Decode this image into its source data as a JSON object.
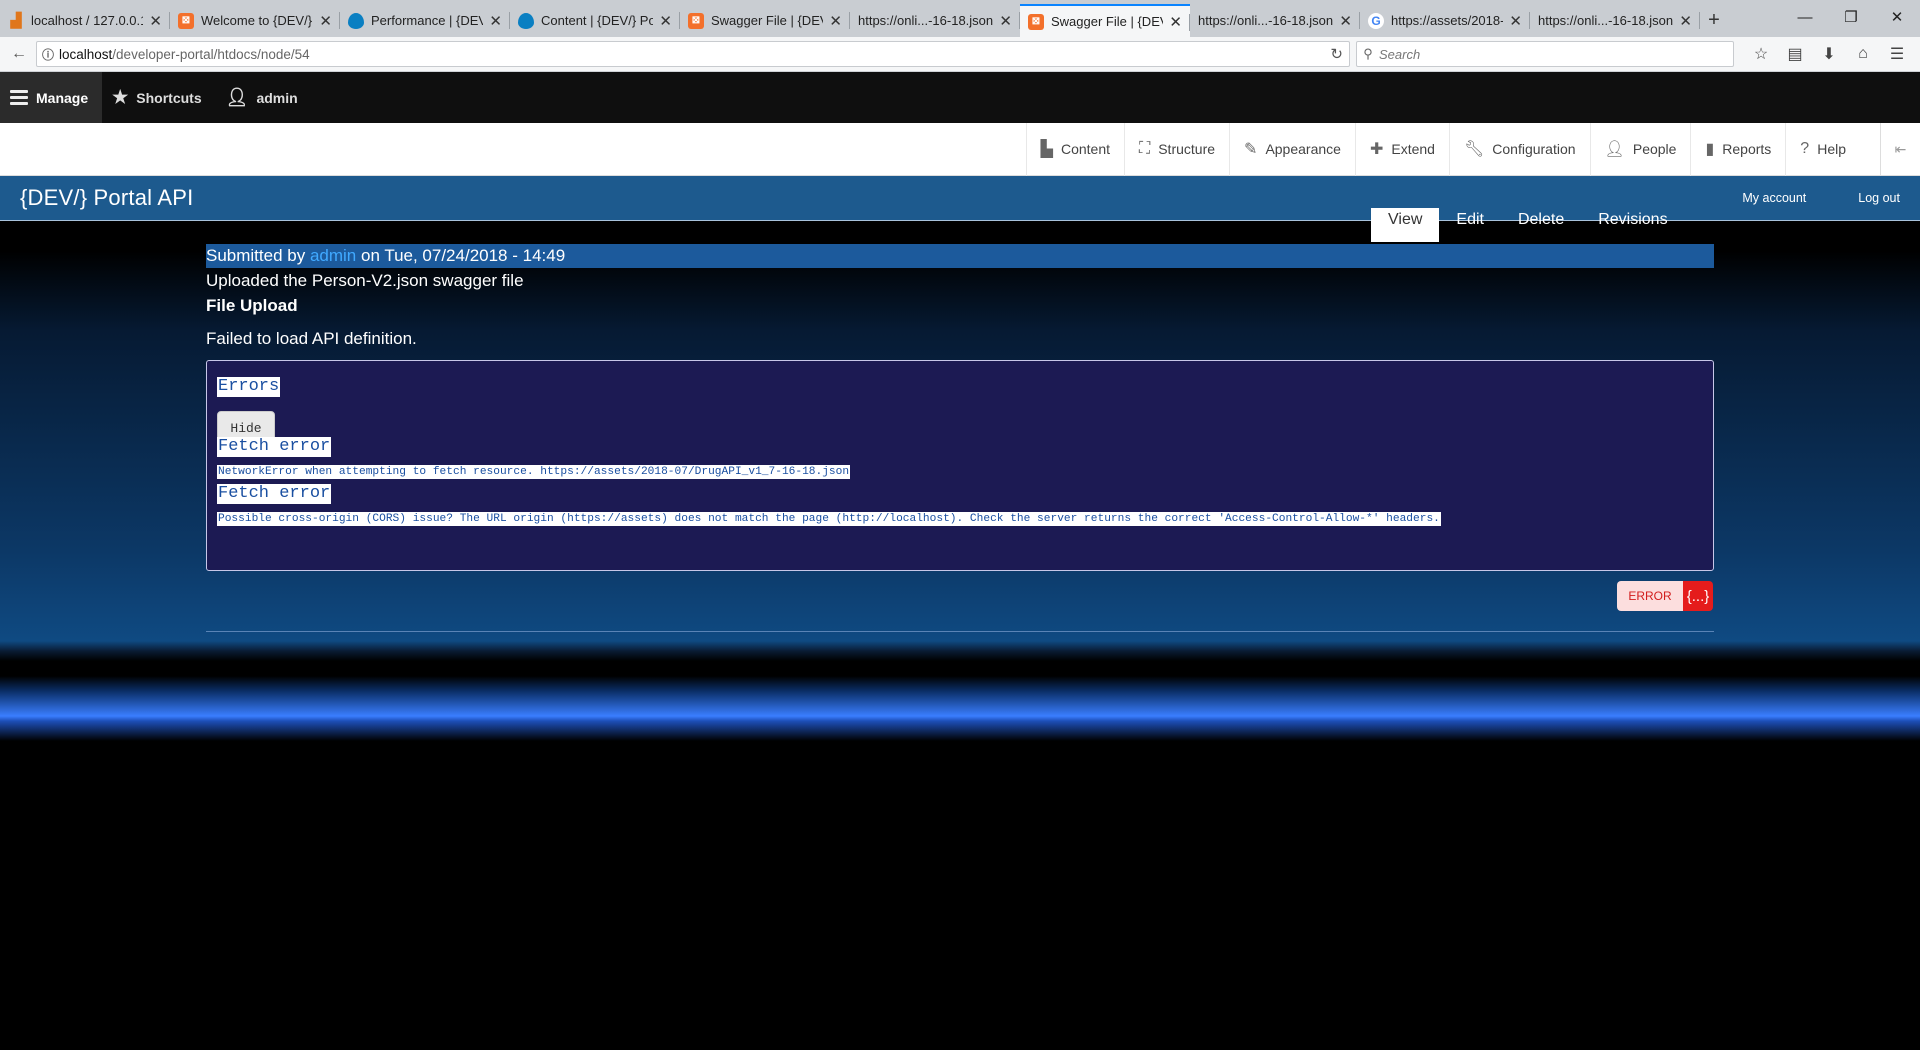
{
  "browser": {
    "tabs": [
      {
        "label": "localhost / 127.0.0.1 /...",
        "icon": "chart-icon",
        "active": false
      },
      {
        "label": "Welcome to {DEV/}...",
        "icon": "xampp-icon",
        "active": false
      },
      {
        "label": "Performance | {DEV/}...",
        "icon": "drupal-icon",
        "active": false
      },
      {
        "label": "Content | {DEV/} Portal",
        "icon": "drupal-icon",
        "active": false
      },
      {
        "label": "Swagger File | {DEV/}...",
        "icon": "xampp-icon",
        "active": false
      },
      {
        "label": "https://onli...-16-18.json",
        "icon": "",
        "active": false
      },
      {
        "label": "Swagger File | {DEV/}...",
        "icon": "xampp-icon",
        "active": true
      },
      {
        "label": "https://onli...-16-18.json",
        "icon": "",
        "active": false
      },
      {
        "label": "https://assets/2018-07...",
        "icon": "google-icon",
        "active": false
      },
      {
        "label": "https://onli...-16-18.json",
        "icon": "",
        "active": false
      }
    ],
    "url_host": "localhost",
    "url_path": "/developer-portal/htdocs/node/54",
    "search_placeholder": "Search"
  },
  "toolbar": {
    "manage": "Manage",
    "shortcuts": "Shortcuts",
    "user": "admin"
  },
  "tray": [
    {
      "label": "Content",
      "icon": "document-icon"
    },
    {
      "label": "Structure",
      "icon": "sitemap-icon"
    },
    {
      "label": "Appearance",
      "icon": "paintbrush-icon"
    },
    {
      "label": "Extend",
      "icon": "puzzle-icon"
    },
    {
      "label": "Configuration",
      "icon": "wrench-icon"
    },
    {
      "label": "People",
      "icon": "person-icon"
    },
    {
      "label": "Reports",
      "icon": "bar-chart-icon"
    },
    {
      "label": "Help",
      "icon": "help-icon"
    }
  ],
  "site": {
    "name": "{DEV/} Portal API",
    "my_account": "My account",
    "logout": "Log out"
  },
  "node_tabs": [
    "View",
    "Edit",
    "Delete",
    "Revisions"
  ],
  "content": {
    "submitted_prefix": "Submitted by ",
    "author": "admin",
    "submitted_suffix": " on Tue, 07/24/2018 - 14:49",
    "uploaded": "Uploaded the Person-V2.json swagger file",
    "field_label": "File Upload",
    "failed": "Failed to load API definition."
  },
  "errors": {
    "heading": "Errors",
    "hide": "Hide",
    "items": [
      {
        "title": "Fetch error",
        "message": "NetworkError when attempting to fetch resource. https://assets/2018-07/DrugAPI_v1_7-16-18.json"
      },
      {
        "title": "Fetch error",
        "message": "Possible cross-origin (CORS) issue? The URL origin (https://assets) does not match the page (http://localhost). Check the server returns the correct 'Access-Control-Allow-*' headers."
      }
    ]
  },
  "validator": {
    "label": "ERROR",
    "symbol": "{...}"
  },
  "colors": {
    "accent": "#1d5a8e",
    "error": "#e51c1c",
    "link": "#40a9ff"
  }
}
